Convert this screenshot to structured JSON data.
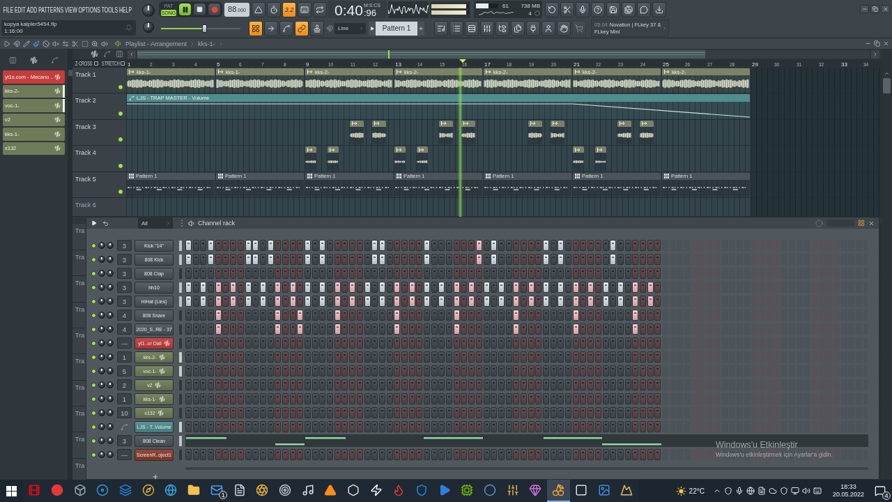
{
  "menu": [
    "FILE",
    "EDIT",
    "ADD",
    "PATTERNS",
    "VIEW",
    "OPTIONS",
    "TOOLS",
    "HELP"
  ],
  "hint_bar": {
    "title": "kopya kalpler5454.flp",
    "text": "1:16:00"
  },
  "transport": {
    "modes": [
      {
        "label": "PAT",
        "selected": false
      },
      {
        "label": "SONG",
        "selected": true
      }
    ],
    "playing": true,
    "recording": false,
    "tempo": "88",
    "tempo_fraction": ".000"
  },
  "record_options": [
    {
      "kind": "metronome",
      "on": false
    },
    {
      "kind": "wait",
      "on": false
    },
    {
      "kind": "countdown",
      "label": "3.2",
      "on": true
    },
    {
      "kind": "step-edit",
      "on": false
    },
    {
      "kind": "loop-record",
      "on": false
    }
  ],
  "time": {
    "value": "0:40",
    "fraction": ":96",
    "format": "M:S:CS"
  },
  "peak_meter": {
    "level": 0.92
  },
  "cpu": {
    "level": 0.55,
    "value": "61",
    "memory": "738 MB",
    "polyphony": "4"
  },
  "tools": [
    {
      "kind": "undo"
    },
    {
      "kind": "cut"
    },
    {
      "kind": "record-audio"
    },
    {
      "kind": "help"
    },
    {
      "kind": "save"
    },
    {
      "kind": "save-new"
    },
    {
      "kind": "chat"
    },
    {
      "kind": "download"
    }
  ],
  "song_position": {
    "level": 0.55
  },
  "snap_tools": [
    {
      "kind": "snap-grid",
      "on": true
    },
    {
      "kind": "arrow",
      "on": false
    },
    {
      "kind": "curve",
      "on": false
    },
    {
      "kind": "link",
      "on": true
    },
    {
      "kind": "stamp",
      "on": false
    }
  ],
  "snap": {
    "value": "Line"
  },
  "pattern": {
    "value": "Pattern 1"
  },
  "window_buttons": [
    {
      "kind": "playlist",
      "disabled": false
    },
    {
      "kind": "piano-roll",
      "disabled": false
    },
    {
      "kind": "channel-rack",
      "disabled": false
    },
    {
      "kind": "mixer",
      "disabled": false
    },
    {
      "kind": "browser",
      "disabled": false
    },
    {
      "kind": "project",
      "disabled": false
    },
    {
      "kind": "plugin",
      "disabled": false
    },
    {
      "kind": "person",
      "disabled": false
    },
    {
      "kind": "hand",
      "disabled": false
    },
    {
      "kind": "cart",
      "disabled": true
    }
  ],
  "news": {
    "date": "05.04",
    "text": "Novation | FLkey 37 & FLkey Mini"
  },
  "playlist": {
    "tools": [
      {
        "kind": "menu",
        "selected": false
      },
      {
        "kind": "magnet",
        "selected": false
      },
      {
        "kind": "draw",
        "selected": false
      },
      {
        "kind": "paint",
        "selected": true
      },
      {
        "kind": "delete",
        "selected": false
      },
      {
        "kind": "mute",
        "selected": false
      },
      {
        "kind": "slip",
        "selected": false
      },
      {
        "kind": "slice",
        "selected": false
      },
      {
        "kind": "select",
        "selected": false
      },
      {
        "kind": "zoom",
        "selected": false
      },
      {
        "kind": "playback",
        "selected": false
      }
    ],
    "title": "Playlist - Arrangement",
    "breadcrumb": "kks-1-",
    "picker_modes": [
      {
        "kind": "pattern",
        "selected": false
      },
      {
        "kind": "audio",
        "selected": true
      },
      {
        "kind": "automation",
        "selected": false
      }
    ],
    "picker": [
      {
        "label": "yt1s.com - Mecano ..",
        "color": "#c43d3d",
        "selected": false
      },
      {
        "label": "kks-2-",
        "color": "#6f7b58",
        "selected": true
      },
      {
        "label": "voc-1-",
        "color": "#6f7b58",
        "selected": true
      },
      {
        "label": "v2",
        "color": "#6f7b58",
        "selected": false
      },
      {
        "label": "kks-1-",
        "color": "#6f7b58",
        "selected": false
      },
      {
        "label": "x132",
        "color": "#6f7b58",
        "selected": false
      }
    ],
    "filter_modes": [
      {
        "kind": "audio",
        "selected": true
      },
      {
        "kind": "automation",
        "selected": false
      },
      {
        "kind": "pattern",
        "selected": false
      }
    ],
    "options": [
      {
        "label": "Z-CROSS",
        "checked": false
      },
      {
        "label": "STRETCH",
        "checked": false
      }
    ],
    "ruler": [
      "1",
      "2",
      "3",
      "4",
      "5",
      "6",
      "7",
      "8",
      "9",
      "10",
      "11",
      "12",
      "13",
      "14",
      "15",
      "16",
      "17",
      "18",
      "19",
      "20",
      "21",
      "22",
      "23",
      "24",
      "25",
      "26",
      "27",
      "28",
      "29",
      "30",
      "31",
      "32",
      "33",
      "34"
    ],
    "playhead": {
      "level": 0.442
    },
    "tracks": [
      {
        "name": "Track 1",
        "on": true,
        "clips": [
          {
            "kind": "audio",
            "label": "kks-1-"
          },
          {
            "kind": "audio",
            "label": "kks-1-"
          },
          {
            "kind": "audio",
            "label": "kks-2-"
          },
          {
            "kind": "audio",
            "label": "kks-2-"
          },
          {
            "kind": "audio",
            "label": "kks-2-"
          },
          {
            "kind": "audio",
            "label": "kks-2-"
          },
          {
            "kind": "audio",
            "label": "kks-2-"
          }
        ]
      },
      {
        "name": "Track 2",
        "on": true,
        "clips": [
          {
            "kind": "automation",
            "label": "LJS - TRAP MASTER - Volume"
          }
        ]
      },
      {
        "name": "Track 3",
        "on": true,
        "clips": [
          {
            "kind": "sample"
          },
          {
            "kind": "sample"
          },
          {
            "kind": "sample"
          },
          {
            "kind": "sample"
          },
          {
            "kind": "sample"
          },
          {
            "kind": "sample"
          },
          {
            "kind": "sample"
          },
          {
            "kind": "sample"
          }
        ]
      },
      {
        "name": "Track 4",
        "on": true,
        "clips": [
          {
            "kind": "sample"
          },
          {
            "kind": "sample"
          },
          {
            "kind": "sample"
          },
          {
            "kind": "sample"
          },
          {
            "kind": "sample"
          },
          {
            "kind": "sample"
          }
        ]
      },
      {
        "name": "Track 5",
        "on": true,
        "clips": [
          {
            "kind": "pattern",
            "label": "Pattern 1"
          },
          {
            "kind": "pattern",
            "label": "Pattern 1"
          },
          {
            "kind": "pattern",
            "label": "Pattern 1"
          },
          {
            "kind": "pattern",
            "label": "Pattern 1"
          },
          {
            "kind": "pattern",
            "label": "Pattern 1"
          },
          {
            "kind": "pattern",
            "label": "Pattern 1"
          },
          {
            "kind": "pattern",
            "label": "Pattern 1"
          }
        ]
      },
      {
        "name": "Track 6"
      }
    ],
    "covered_tracks": [
      "Tra",
      "Tra",
      "Tra",
      "Tra",
      "Tra",
      "Tra",
      "Tra",
      "Tra",
      "Tra",
      "Tra"
    ]
  },
  "channel_rack": {
    "filter": "All",
    "title": "Channel rack",
    "channels": [
      {
        "name": "Kick \"14\"",
        "kind": "sampler",
        "track": "3",
        "color": "#4b5358",
        "on": true,
        "selected": true,
        "steps": [
          true,
          false,
          false,
          true,
          false,
          false,
          false,
          false,
          true,
          true,
          false,
          true,
          false,
          false,
          false,
          false,
          true,
          false,
          true,
          false,
          false,
          false,
          false,
          false,
          false,
          true,
          true,
          false,
          false,
          false,
          false,
          false,
          true,
          false,
          false,
          false,
          false,
          false,
          false,
          true,
          false,
          true,
          false,
          false,
          false,
          false,
          false,
          false,
          true,
          false,
          true,
          false,
          false,
          false,
          false,
          false,
          false,
          true,
          false,
          false,
          false,
          false,
          false,
          false
        ]
      },
      {
        "name": "808 Kick",
        "kind": "sampler",
        "track": "3",
        "color": "#4b5358",
        "on": true,
        "selected": true,
        "steps": [
          true,
          false,
          false,
          true,
          false,
          false,
          false,
          false,
          true,
          true,
          false,
          true,
          false,
          false,
          false,
          false,
          true,
          false,
          true,
          false,
          false,
          false,
          false,
          false,
          false,
          true,
          true,
          false,
          false,
          false,
          false,
          false,
          true,
          false,
          false,
          false,
          false,
          false,
          false,
          true,
          false,
          true,
          false,
          false,
          false,
          false,
          false,
          false,
          true,
          false,
          true,
          false,
          false,
          false,
          false,
          false,
          false,
          true,
          false,
          false,
          false,
          false,
          false,
          false
        ]
      },
      {
        "name": "808 Clap",
        "kind": "sampler",
        "track": "3",
        "color": "#4b5358",
        "on": true,
        "selected": false,
        "steps": [
          false,
          false,
          false,
          false,
          false,
          false,
          false,
          false,
          false,
          false,
          false,
          false,
          false,
          false,
          false,
          false,
          false,
          false,
          false,
          false,
          false,
          false,
          false,
          false,
          false,
          false,
          false,
          false,
          false,
          false,
          false,
          false,
          false,
          false,
          false,
          false,
          false,
          false,
          false,
          false,
          false,
          false,
          false,
          false,
          false,
          false,
          false,
          false,
          false,
          false,
          false,
          false,
          false,
          false,
          false,
          false,
          false,
          false,
          false,
          false,
          false,
          false,
          false,
          false
        ]
      },
      {
        "name": "hh10",
        "kind": "sampler",
        "track": "3",
        "color": "#4b5358",
        "on": true,
        "selected": true,
        "steps": [
          true,
          false,
          true,
          false,
          true,
          false,
          true,
          false,
          true,
          false,
          true,
          false,
          true,
          false,
          true,
          false,
          true,
          false,
          true,
          false,
          true,
          false,
          true,
          false,
          true,
          false,
          true,
          false,
          true,
          false,
          true,
          false,
          true,
          false,
          true,
          false,
          true,
          false,
          true,
          false,
          true,
          false,
          true,
          false,
          true,
          false,
          true,
          false,
          true,
          false,
          true,
          false,
          true,
          false,
          true,
          false,
          true,
          false,
          true,
          false,
          true,
          false,
          true,
          false
        ]
      },
      {
        "name": "HiHat (Lies)",
        "kind": "sampler",
        "track": "3",
        "color": "#4b5358",
        "on": true,
        "selected": true,
        "steps": [
          true,
          false,
          true,
          false,
          true,
          false,
          true,
          false,
          true,
          false,
          true,
          false,
          true,
          false,
          true,
          false,
          true,
          false,
          true,
          false,
          true,
          false,
          true,
          false,
          true,
          false,
          true,
          false,
          true,
          false,
          true,
          false,
          true,
          false,
          true,
          false,
          true,
          false,
          true,
          false,
          true,
          false,
          true,
          false,
          true,
          false,
          true,
          false,
          true,
          false,
          true,
          false,
          true,
          false,
          true,
          false,
          true,
          false,
          true,
          false,
          true,
          false,
          true,
          false
        ]
      },
      {
        "name": "808 Snare",
        "kind": "sampler",
        "track": "4",
        "color": "#4b5358",
        "on": true,
        "selected": false,
        "steps": [
          false,
          false,
          false,
          false,
          true,
          false,
          false,
          false,
          false,
          false,
          false,
          false,
          true,
          false,
          false,
          true,
          false,
          false,
          false,
          false,
          true,
          false,
          false,
          false,
          false,
          false,
          false,
          false,
          true,
          false,
          false,
          false,
          false,
          false,
          false,
          false,
          true,
          false,
          false,
          false,
          false,
          false,
          false,
          false,
          true,
          false,
          false,
          false,
          false,
          false,
          false,
          false,
          true,
          false,
          false,
          false,
          false,
          false,
          false,
          false,
          true,
          false,
          false,
          false
        ]
      },
      {
        "name": "2020_S..RE - 37",
        "kind": "sampler",
        "track": "4",
        "color": "#4b5358",
        "on": true,
        "selected": false,
        "steps": [
          false,
          false,
          false,
          false,
          true,
          false,
          false,
          false,
          false,
          false,
          false,
          false,
          true,
          false,
          false,
          true,
          false,
          false,
          false,
          false,
          true,
          false,
          false,
          false,
          false,
          false,
          false,
          false,
          true,
          false,
          false,
          false,
          false,
          false,
          false,
          false,
          true,
          false,
          false,
          false,
          false,
          false,
          false,
          false,
          true,
          false,
          false,
          false,
          false,
          false,
          false,
          false,
          true,
          false,
          false,
          false,
          false,
          false,
          false,
          false,
          true,
          false,
          false,
          false
        ]
      },
      {
        "name": "yt1..or Dali",
        "kind": "audio",
        "track": "---",
        "color": "#c23a3a",
        "on": true,
        "selected": false,
        "steps": [
          false,
          false,
          false,
          false,
          false,
          false,
          false,
          false,
          false,
          false,
          false,
          false,
          false,
          false,
          false,
          false,
          false,
          false,
          false,
          false,
          false,
          false,
          false,
          false,
          false,
          false,
          false,
          false,
          false,
          false,
          false,
          false,
          false,
          false,
          false,
          false,
          false,
          false,
          false,
          false,
          false,
          false,
          false,
          false,
          false,
          false,
          false,
          false,
          false,
          false,
          false,
          false,
          false,
          false,
          false,
          false,
          false,
          false,
          false,
          false,
          false,
          false,
          false,
          false
        ]
      },
      {
        "name": "kks-2-",
        "kind": "audio",
        "track": "1",
        "color": "#6e7a56",
        "on": true,
        "selected": true,
        "steps": [
          false,
          false,
          false,
          false,
          false,
          false,
          false,
          false,
          false,
          false,
          false,
          false,
          false,
          false,
          false,
          false,
          false,
          false,
          false,
          false,
          false,
          false,
          false,
          false,
          false,
          false,
          false,
          false,
          false,
          false,
          false,
          false,
          false,
          false,
          false,
          false,
          false,
          false,
          false,
          false,
          false,
          false,
          false,
          false,
          false,
          false,
          false,
          false,
          false,
          false,
          false,
          false,
          false,
          false,
          false,
          false,
          false,
          false,
          false,
          false,
          false,
          false,
          false,
          false
        ]
      },
      {
        "name": "voc-1-",
        "kind": "audio",
        "track": "5",
        "color": "#6e7a56",
        "on": true,
        "selected": true,
        "steps": [
          false,
          false,
          false,
          false,
          false,
          false,
          false,
          false,
          false,
          false,
          false,
          false,
          false,
          false,
          false,
          false,
          false,
          false,
          false,
          false,
          false,
          false,
          false,
          false,
          false,
          false,
          false,
          false,
          false,
          false,
          false,
          false,
          false,
          false,
          false,
          false,
          false,
          false,
          false,
          false,
          false,
          false,
          false,
          false,
          false,
          false,
          false,
          false,
          false,
          false,
          false,
          false,
          false,
          false,
          false,
          false,
          false,
          false,
          false,
          false,
          false,
          false,
          false,
          false
        ]
      },
      {
        "name": "v2",
        "kind": "audio",
        "track": "2",
        "color": "#6e7a56",
        "on": true,
        "selected": false,
        "steps": [
          false,
          false,
          false,
          false,
          false,
          false,
          false,
          false,
          false,
          false,
          false,
          false,
          false,
          false,
          false,
          false,
          false,
          false,
          false,
          false,
          false,
          false,
          false,
          false,
          false,
          false,
          false,
          false,
          false,
          false,
          false,
          false,
          false,
          false,
          false,
          false,
          false,
          false,
          false,
          false,
          false,
          false,
          false,
          false,
          false,
          false,
          false,
          false,
          false,
          false,
          false,
          false,
          false,
          false,
          false,
          false,
          false,
          false,
          false,
          false,
          false,
          false,
          false,
          false
        ]
      },
      {
        "name": "kks-1-",
        "kind": "audio",
        "track": "1",
        "color": "#6e7a56",
        "on": true,
        "selected": false,
        "steps": [
          false,
          false,
          false,
          false,
          false,
          false,
          false,
          false,
          false,
          false,
          false,
          false,
          false,
          false,
          false,
          false,
          false,
          false,
          false,
          false,
          false,
          false,
          false,
          false,
          false,
          false,
          false,
          false,
          false,
          false,
          false,
          false,
          false,
          false,
          false,
          false,
          false,
          false,
          false,
          false,
          false,
          false,
          false,
          false,
          false,
          false,
          false,
          false,
          false,
          false,
          false,
          false,
          false,
          false,
          false,
          false,
          false,
          false,
          false,
          false,
          false,
          false,
          false,
          false
        ]
      },
      {
        "name": "x132",
        "kind": "audio",
        "track": "10",
        "color": "#6e7a56",
        "on": true,
        "selected": false,
        "steps": [
          false,
          false,
          false,
          false,
          false,
          false,
          false,
          false,
          false,
          false,
          false,
          false,
          false,
          false,
          false,
          false,
          false,
          false,
          false,
          false,
          false,
          false,
          false,
          false,
          false,
          false,
          false,
          false,
          false,
          false,
          false,
          false,
          false,
          false,
          false,
          false,
          false,
          false,
          false,
          false,
          false,
          false,
          false,
          false,
          false,
          false,
          false,
          false,
          false,
          false,
          false,
          false,
          false,
          false,
          false,
          false,
          false,
          false,
          false,
          false,
          false,
          false,
          false,
          false
        ]
      },
      {
        "name": "LJS - T..Volume",
        "kind": "automation",
        "color": "#4a8c8e",
        "on": true,
        "selected": true,
        "steps": [
          false,
          false,
          false,
          false,
          false,
          false,
          false,
          false,
          false,
          false,
          false,
          false,
          false,
          false,
          false,
          false,
          false,
          false,
          false,
          false,
          false,
          false,
          false,
          false,
          false,
          false,
          false,
          false,
          false,
          false,
          false,
          false,
          false,
          false,
          false,
          false,
          false,
          false,
          false,
          false,
          false,
          false,
          false,
          false,
          false,
          false,
          false,
          false,
          false,
          false,
          false,
          false,
          false,
          false,
          false,
          false,
          false,
          false,
          false,
          false,
          false,
          false,
          false,
          false
        ]
      },
      {
        "name": "808 Clean",
        "kind": "pianoroll",
        "track": "3",
        "color": "#4b5358",
        "on": true,
        "selected": true
      },
      {
        "name": "ScreenR..oject1",
        "kind": "sampler",
        "track": "---",
        "color": "#8c3a28",
        "on": true,
        "selected": false,
        "steps": [
          false,
          false,
          false,
          false,
          false,
          false,
          false,
          false,
          false,
          false,
          false,
          false,
          false,
          false,
          false,
          false,
          false,
          false,
          false,
          false,
          false,
          false,
          false,
          false,
          false,
          false,
          false,
          false,
          false,
          false,
          false,
          false,
          false,
          false,
          false,
          false,
          false,
          false,
          false,
          false,
          false,
          false,
          false,
          false,
          false,
          false,
          false,
          false,
          false,
          false,
          false,
          false,
          false,
          false,
          false,
          false,
          false,
          false,
          false,
          false,
          false,
          false,
          false,
          false
        ]
      }
    ]
  },
  "taskbar": {
    "apps": [
      {
        "kind": "film",
        "selected": false
      },
      {
        "kind": "record",
        "selected": false
      },
      {
        "kind": "box",
        "selected": false
      },
      {
        "kind": "disc",
        "selected": false
      },
      {
        "kind": "layers",
        "selected": false
      },
      {
        "kind": "compass",
        "selected": false
      },
      {
        "kind": "globe",
        "selected": false
      },
      {
        "kind": "folder",
        "selected": false
      },
      {
        "kind": "mail",
        "selected": false,
        "badge": "1"
      },
      {
        "kind": "document",
        "selected": false
      },
      {
        "kind": "aperture",
        "selected": false
      },
      {
        "kind": "target",
        "selected": false
      },
      {
        "kind": "music",
        "selected": false
      },
      {
        "kind": "cone",
        "selected": false
      },
      {
        "kind": "hexagon",
        "selected": false
      },
      {
        "kind": "zap",
        "selected": false
      },
      {
        "kind": "flame",
        "selected": false
      },
      {
        "kind": "shield",
        "selected": false
      },
      {
        "kind": "play",
        "selected": false
      },
      {
        "kind": "cpu",
        "selected": false
      },
      {
        "kind": "circle",
        "selected": false
      },
      {
        "kind": "sliders",
        "selected": false
      },
      {
        "kind": "gem",
        "selected": false
      },
      {
        "kind": "cherry",
        "selected": true
      },
      {
        "kind": "square",
        "selected": false
      },
      {
        "kind": "image",
        "selected": false
      },
      {
        "kind": "mountain",
        "selected": false
      }
    ],
    "weather": "22°C",
    "tray": [
      {
        "kind": "chevron"
      },
      {
        "kind": "shield"
      },
      {
        "kind": "mic"
      },
      {
        "kind": "globe"
      },
      {
        "kind": "file"
      },
      {
        "kind": "cloud"
      },
      {
        "kind": "shield"
      },
      {
        "kind": "monitor"
      },
      {
        "kind": "speaker"
      },
      {
        "kind": "keyboard"
      }
    ],
    "time": "18:33",
    "date": "20.05.2022",
    "notifications": "4"
  },
  "activation": {
    "title": "Windows'u Etkinleştir",
    "text": "Windows'u etkinleştirmek için Ayarlar'a gidin."
  }
}
